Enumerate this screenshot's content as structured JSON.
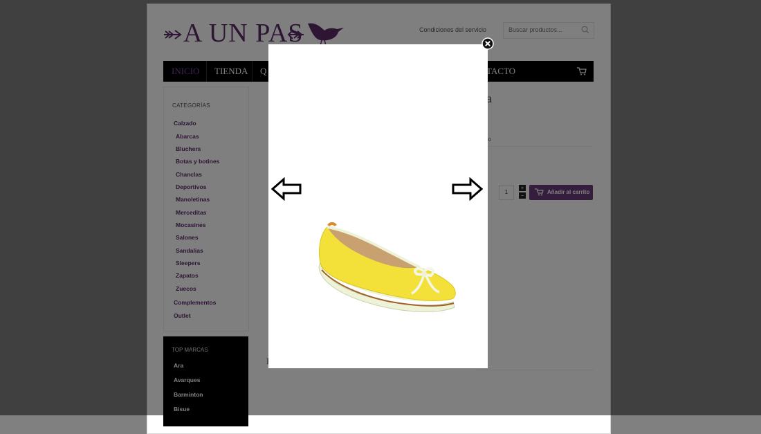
{
  "header": {
    "logo_text": "A UN PAS",
    "top_link": "Condiciones del servicio",
    "search_placeholder": "Buscar productos..."
  },
  "nav": {
    "items": [
      "INICIO",
      "TIENDA",
      "Q",
      "TACTO"
    ]
  },
  "sidebar": {
    "title": "CATEGORÍAS",
    "top_category": "Calzado",
    "subcategories": [
      "Abarcas",
      "Bluchers",
      "Botas y botines",
      "Chanclas",
      "Deportivos",
      "Manoletinas",
      "Merceditas",
      "Mocasines",
      "Salones",
      "Sandalias",
      "Sleepers",
      "Zapatos",
      "Zuecos"
    ],
    "other_categories": [
      "Complementos",
      "Outlet"
    ]
  },
  "brands": {
    "title": "TOP MARCAS",
    "items": [
      "Ara",
      "Avarques",
      "Barminton",
      "Bisue"
    ]
  },
  "product": {
    "title_fragment": "illa",
    "tab_fragment": "ucto",
    "quantity": "1",
    "add_to_cart": "Añadir al carrito"
  },
  "lightbox": {
    "image_alt": "yellow ballerina shoe",
    "colors": {
      "shoe": "#f3e13a",
      "trim": "#eef3d8",
      "sole_stripe": "#a0622a"
    }
  },
  "colors": {
    "brand": "#5b2a66",
    "nav_bg": "#000000",
    "nav_active": "#7a4aa0",
    "button": "#6b3c7a"
  }
}
